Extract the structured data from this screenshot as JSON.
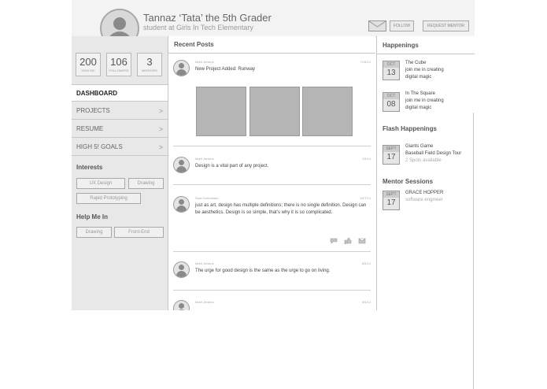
{
  "profile": {
    "name": "Tannaz ‘Tata’ the 5th Grader",
    "subtitle": "student at Girls In Tech Elementary",
    "follow_label": "FOLLOW",
    "request_mentor_label": "REQUEST MENTOR"
  },
  "stats": [
    {
      "value": "200",
      "label": "HIGH 5s!"
    },
    {
      "value": "106",
      "label": "FOLLOWERS"
    },
    {
      "value": "3",
      "label": "MENTORS"
    }
  ],
  "nav": [
    {
      "label": "DASHBOARD"
    },
    {
      "label": "PROJECTS",
      "chevron": ">"
    },
    {
      "label": "RESUME",
      "chevron": ">"
    },
    {
      "label": "HIGH 5! GOALS",
      "chevron": ">"
    }
  ],
  "interests": {
    "title": "Interests",
    "tags": [
      "UX Design",
      "Drawing",
      "Rapid Prototyping"
    ]
  },
  "help": {
    "title": "Help Me In",
    "tags": [
      "Drawing",
      "Front-End"
    ]
  },
  "feed": {
    "title": "Recent Posts",
    "posts": [
      {
        "author": "Marti Jenkins",
        "date": "7/15/14",
        "text": "New Project Added: Runway"
      },
      {
        "author": "Marti Jenkins",
        "date": "7/8/14",
        "text": "Design is a vital part of any project."
      },
      {
        "author": "Sara Garboddah",
        "date": "6/27/14",
        "text": "just as art, design has multiple definitions; there is no single definition. Design can be aesthetics. Design is so simple, that’s why it is so complicated."
      },
      {
        "author": "Marti Jenkins",
        "date": "6/5/14",
        "text": "The urge for good design is the same as the urge to go on living."
      },
      {
        "author": "Marti Jenkins",
        "date": "6/5/14",
        "text": ""
      }
    ]
  },
  "happenings": {
    "title": "Happenings",
    "events": [
      {
        "month": "OCT",
        "day": "13",
        "title": "The Cube",
        "desc1": "join me in creating",
        "desc2": "digital magic"
      },
      {
        "month": "OCT",
        "day": "08",
        "title": "In The Square",
        "desc1": "join me in creating",
        "desc2": "digital magic"
      }
    ]
  },
  "flash": {
    "title": "Flash Happenings",
    "event": {
      "month": "SEPT",
      "day": "17",
      "line1": "Giants Game",
      "line2": "Baseball Field Design Tour",
      "line3": "2 Spots available"
    }
  },
  "mentor": {
    "title": "Mentor Sessions",
    "event": {
      "month": "SEPT",
      "day": "17",
      "line1": "GRACE HOPPER",
      "line2": "software engineer"
    }
  }
}
